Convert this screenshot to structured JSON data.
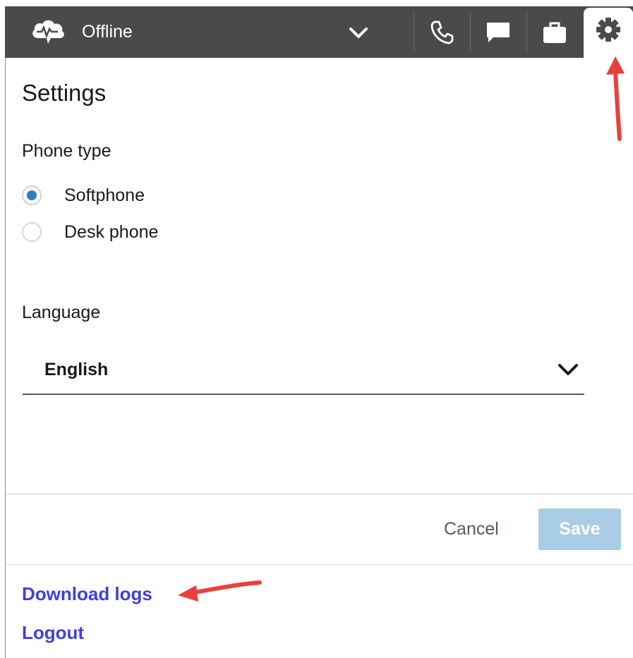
{
  "topbar": {
    "status_icon": "cloud-pulse-icon",
    "status_label": "Offline",
    "icons": [
      "chevron-down-icon",
      "phone-icon",
      "chat-icon",
      "briefcase-icon",
      "gear-icon"
    ]
  },
  "settings": {
    "title": "Settings",
    "phone_type_label": "Phone type",
    "phone_options": [
      {
        "label": "Softphone",
        "selected": true
      },
      {
        "label": "Desk phone",
        "selected": false
      }
    ],
    "language_label": "Language",
    "language_value": "English",
    "cancel_label": "Cancel",
    "save_label": "Save"
  },
  "links": {
    "download_logs": "Download logs",
    "logout": "Logout"
  },
  "colors": {
    "topbar": "#4a4a4a",
    "radio_selected": "#2e7dbe",
    "save_disabled": "#a9cde4",
    "link": "#3f3fe0",
    "annotation_arrow": "#e8403f"
  }
}
